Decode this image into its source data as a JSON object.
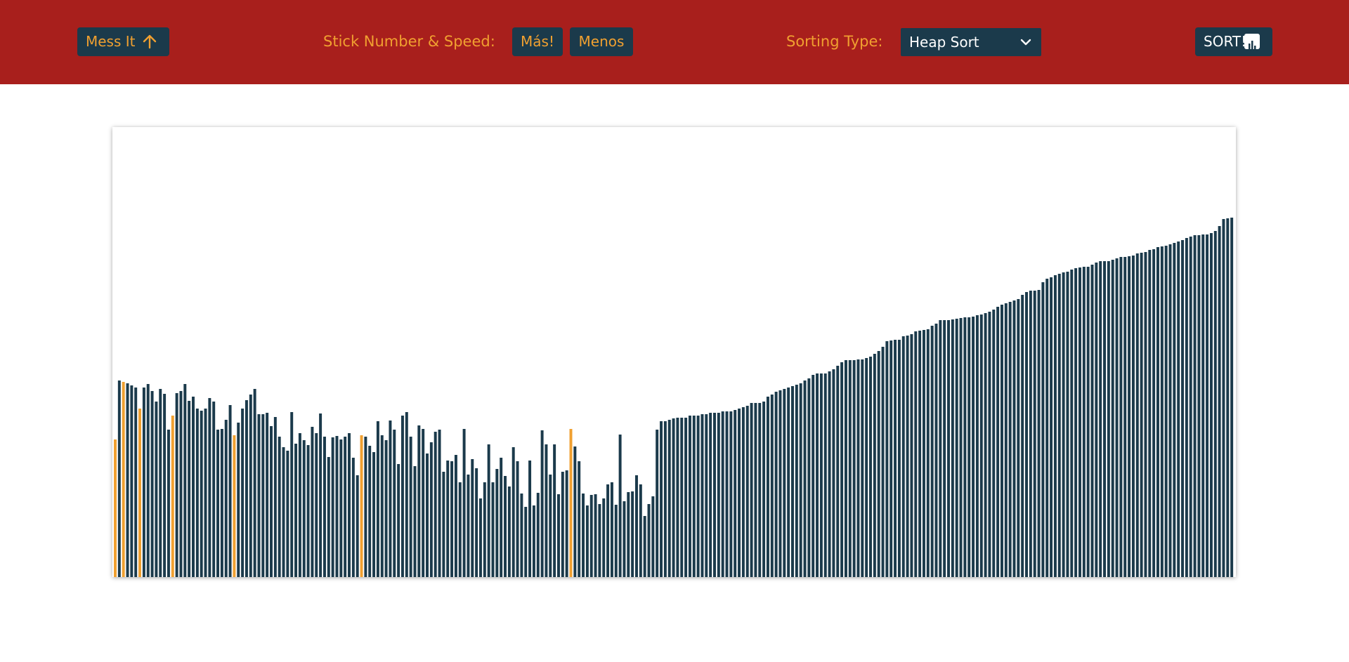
{
  "header": {
    "mess_label": "Mess It",
    "speed_label": "Stick Number & Speed:",
    "more_label": "Más!",
    "less_label": "Menos",
    "sorting_label": "Sorting Type:",
    "sort_select_value": "Heap Sort",
    "sort_label": "SORT!"
  },
  "colors": {
    "header_bg": "#a81f1c",
    "accent": "#f0a030",
    "button_bg": "#1b3a4b",
    "bar_default": "#1b3a4b",
    "bar_highlight": "#f0a030"
  },
  "icons": {
    "mess": "arrow-up-icon",
    "select": "chevron-down-icon",
    "sort": "bar-chart-icon"
  },
  "chart_data": {
    "type": "bar",
    "ylim": [
      0,
      641
    ],
    "values": [
      196,
      280,
      278,
      276,
      273,
      270,
      240,
      270,
      275,
      265,
      250,
      268,
      261,
      210,
      230,
      262,
      265,
      275,
      251,
      257,
      240,
      237,
      240,
      255,
      250,
      210,
      211,
      224,
      245,
      202,
      220,
      240,
      252,
      260,
      268,
      232,
      232,
      234,
      215,
      228,
      200,
      185,
      180,
      235,
      190,
      205,
      195,
      188,
      214,
      205,
      233,
      200,
      171,
      199,
      201,
      196,
      200,
      205,
      170,
      145,
      202,
      200,
      187,
      178,
      222,
      202,
      195,
      223,
      210,
      161,
      230,
      235,
      200,
      158,
      216,
      211,
      176,
      192,
      207,
      210,
      150,
      166,
      165,
      174,
      135,
      211,
      146,
      168,
      155,
      112,
      135,
      189,
      135,
      154,
      170,
      144,
      129,
      185,
      165,
      119,
      100,
      166,
      102,
      120,
      209,
      189,
      146,
      189,
      118,
      150,
      152,
      211,
      186,
      165,
      119,
      102,
      117,
      118,
      104,
      112,
      132,
      135,
      103,
      203,
      108,
      121,
      122,
      145,
      132,
      87,
      104,
      115,
      210,
      222,
      222,
      224,
      226,
      227,
      227,
      227,
      230,
      230,
      230,
      232,
      232,
      234,
      234,
      234,
      236,
      236,
      236,
      238,
      240,
      242,
      244,
      248,
      248,
      248,
      250,
      257,
      260,
      264,
      266,
      268,
      270,
      272,
      274,
      276,
      280,
      283,
      288,
      290,
      290,
      290,
      293,
      296,
      301,
      306,
      309,
      309,
      309,
      310,
      310,
      312,
      314,
      318,
      322,
      328,
      336,
      337,
      338,
      338,
      343,
      344,
      346,
      350,
      351,
      352,
      353,
      358,
      361,
      366,
      366,
      366,
      367,
      368,
      369,
      370,
      370,
      371,
      373,
      374,
      376,
      378,
      381,
      385,
      388,
      390,
      392,
      394,
      396,
      402,
      406,
      408,
      408,
      409,
      420,
      425,
      427,
      430,
      432,
      434,
      435,
      438,
      440,
      441,
      442,
      442,
      445,
      448,
      450,
      450,
      450,
      452,
      454,
      456,
      456,
      457,
      458,
      461,
      462,
      463,
      466,
      467,
      470,
      471,
      472,
      474,
      476,
      478,
      480,
      483,
      485,
      487,
      487,
      488,
      488,
      490,
      493,
      500,
      510,
      511,
      512
    ],
    "highlighted": [
      0,
      2,
      6,
      14,
      29,
      60,
      111
    ]
  }
}
